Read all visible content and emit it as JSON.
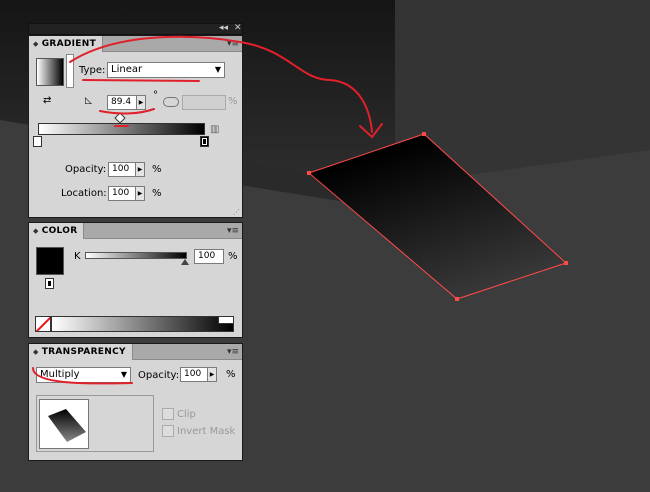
{
  "gradient_panel": {
    "tab": "GRADIENT",
    "type_label": "Type:",
    "type_value": "Linear",
    "angle_value": "89.4",
    "degree_symbol": "°",
    "aspect_unit": "%",
    "opacity_label": "Opacity:",
    "opacity_value": "100",
    "location_label": "Location:",
    "location_value": "100",
    "percent": "%"
  },
  "color_panel": {
    "tab": "COLOR",
    "channel_label": "K",
    "channel_value": "100",
    "percent": "%"
  },
  "transparency_panel": {
    "tab": "TRANSPARENCY",
    "blend_mode": "Multiply",
    "opacity_label": "Opacity:",
    "opacity_value": "100",
    "percent": "%",
    "clip_label": "Clip",
    "invert_mask_label": "Invert Mask"
  },
  "titlebar": {
    "collapse": "◂◂",
    "close": "✕"
  },
  "colors": {
    "panel_bg": "#d6d6d6",
    "artboard_bg": "#3d3d3d",
    "selection": "#ff4444",
    "annotation": "#e0202a"
  }
}
